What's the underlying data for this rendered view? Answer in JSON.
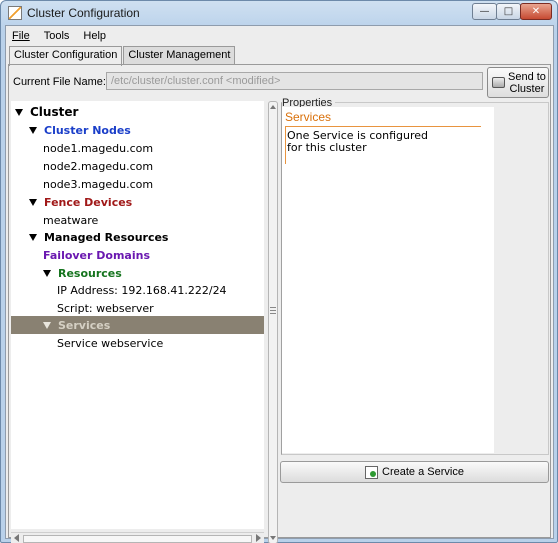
{
  "window": {
    "title": "Cluster Configuration",
    "controls": {
      "minimize": "—",
      "maximize": "□",
      "close": "✕"
    }
  },
  "menu": [
    {
      "label": "File"
    },
    {
      "label": "Tools"
    },
    {
      "label": "Help"
    }
  ],
  "tabs": [
    {
      "label": "Cluster Configuration",
      "active": true
    },
    {
      "label": "Cluster Management",
      "active": false
    }
  ],
  "file": {
    "label": "Current File Name:",
    "value": "/etc/cluster/cluster.conf <modified>"
  },
  "send_button": {
    "line1": "Send to",
    "line2": "Cluster",
    "icon": "send-cluster-icon"
  },
  "tree": [
    {
      "label": "Cluster",
      "level": 0,
      "expanded": true,
      "bold": true,
      "color": "#000000"
    },
    {
      "label": "Cluster Nodes",
      "level": 1,
      "expanded": true,
      "bold": true,
      "color": "#1a3ec9"
    },
    {
      "label": "node1.magedu.com",
      "level": 2,
      "expanded": false,
      "bold": false,
      "color": "#000000"
    },
    {
      "label": "node2.magedu.com",
      "level": 2,
      "expanded": false,
      "bold": false,
      "color": "#000000"
    },
    {
      "label": "node3.magedu.com",
      "level": 2,
      "expanded": false,
      "bold": false,
      "color": "#000000"
    },
    {
      "label": "Fence Devices",
      "level": 1,
      "expanded": true,
      "bold": true,
      "color": "#a01818"
    },
    {
      "label": "meatware",
      "level": 2,
      "expanded": false,
      "bold": false,
      "color": "#000000"
    },
    {
      "label": "Managed Resources",
      "level": 1,
      "expanded": true,
      "bold": true,
      "color": "#000000"
    },
    {
      "label": "Failover Domains",
      "level": 2,
      "expanded": false,
      "bold": true,
      "color": "#6a18b0"
    },
    {
      "label": "Resources",
      "level": 2,
      "expanded": true,
      "bold": true,
      "color": "#15741e"
    },
    {
      "label": "IP Address:  192.168.41.222/24",
      "level": 3,
      "expanded": false,
      "bold": false,
      "color": "#000000"
    },
    {
      "label": "Script:  webserver",
      "level": 3,
      "expanded": false,
      "bold": false,
      "color": "#000000"
    },
    {
      "label": "Services",
      "level": 2,
      "expanded": true,
      "bold": true,
      "color": "#d5d0c4",
      "selected": true
    },
    {
      "label": "Service webservice",
      "level": 3,
      "expanded": false,
      "bold": false,
      "color": "#000000"
    }
  ],
  "properties": {
    "legend": "Properties",
    "heading": "Services",
    "text": "One Service is configured\n for this cluster"
  },
  "create_button": {
    "label": "Create a Service",
    "icon": "create-service-icon"
  },
  "colors": {
    "accent_orange": "#d9700a",
    "selection": "#898172"
  }
}
